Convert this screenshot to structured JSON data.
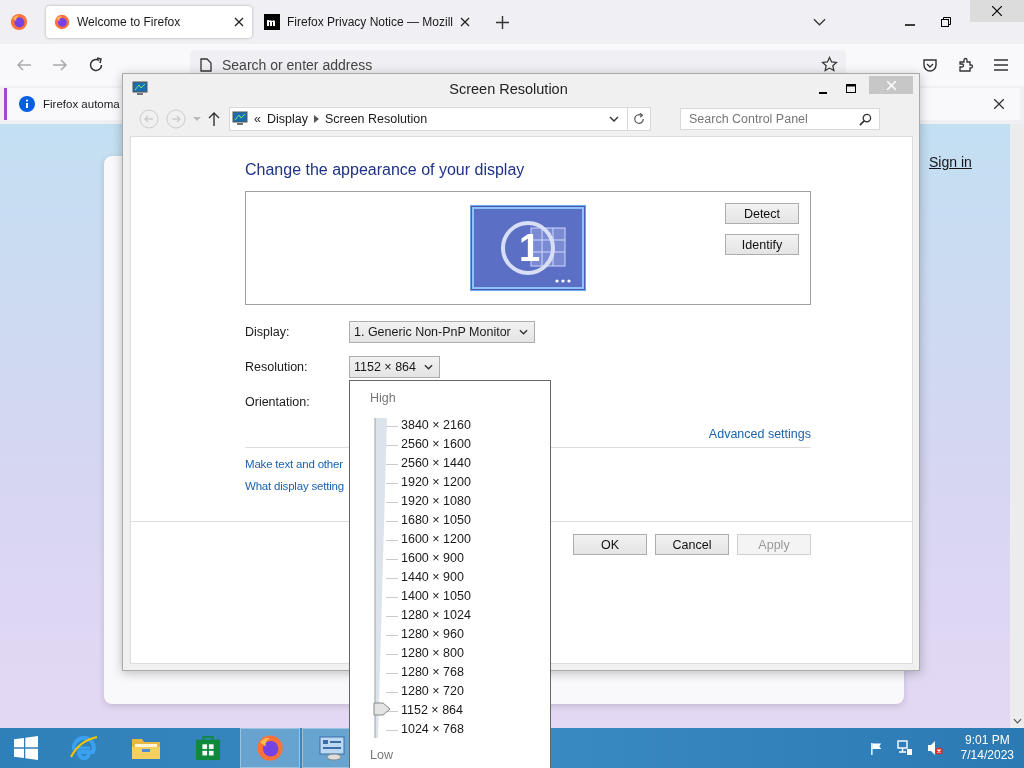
{
  "browser": {
    "tabs": [
      {
        "title": "Welcome to Firefox",
        "selected": true,
        "kind": "firefox"
      },
      {
        "title": "Firefox Privacy Notice — Mozill",
        "selected": false,
        "kind": "mozilla"
      }
    ],
    "address": {
      "placeholder": "Search or enter address"
    },
    "notification": {
      "text": "Firefox automa"
    },
    "page": {
      "sign_in": "Sign in"
    }
  },
  "dialog": {
    "title": "Screen Resolution",
    "overflow": "«",
    "breadcrumb": [
      "Display",
      "Screen Resolution"
    ],
    "search": {
      "placeholder": "Search Control Panel"
    },
    "heading": "Change the appearance of your display",
    "monitor_number": "1",
    "side_buttons": [
      "Detect",
      "Identify"
    ],
    "fields": [
      {
        "label": "Display:",
        "value": "1. Generic Non-PnP Monitor"
      },
      {
        "label": "Resolution:",
        "value": "1152 × 864"
      },
      {
        "label": "Orientation:"
      }
    ],
    "advanced": "Advanced settings",
    "links": [
      "Make text and other",
      "What display setting"
    ],
    "buttons": [
      {
        "label": "OK",
        "disabled": false
      },
      {
        "label": "Cancel",
        "disabled": false
      },
      {
        "label": "Apply",
        "disabled": true
      }
    ]
  },
  "resolution_menu": {
    "high": "High",
    "low": "Low",
    "options": [
      {
        "label": "3840 × 2160",
        "selected": false
      },
      {
        "label": "2560 × 1600",
        "selected": false
      },
      {
        "label": "2560 × 1440",
        "selected": false
      },
      {
        "label": "1920 × 1200",
        "selected": false
      },
      {
        "label": "1920 × 1080",
        "selected": false
      },
      {
        "label": "1680 × 1050",
        "selected": false
      },
      {
        "label": "1600 × 1200",
        "selected": false
      },
      {
        "label": "1600 × 900",
        "selected": false
      },
      {
        "label": "1440 × 900",
        "selected": false
      },
      {
        "label": "1400 × 1050",
        "selected": false
      },
      {
        "label": "1280 × 1024",
        "selected": false
      },
      {
        "label": "1280 × 960",
        "selected": false
      },
      {
        "label": "1280 × 800",
        "selected": false
      },
      {
        "label": "1280 × 768",
        "selected": false
      },
      {
        "label": "1280 × 720",
        "selected": false
      },
      {
        "label": "1152 × 864",
        "selected": true
      },
      {
        "label": "1024 × 768",
        "selected": false
      }
    ]
  },
  "taskbar": {
    "apps": [
      {
        "kind": "ie",
        "active": false
      },
      {
        "kind": "explorer",
        "active": false
      },
      {
        "kind": "store",
        "active": false
      },
      {
        "kind": "firefox",
        "active": true
      },
      {
        "kind": "control-panel",
        "active": true
      }
    ],
    "time": "9:01 PM",
    "date": "7/14/2023"
  }
}
